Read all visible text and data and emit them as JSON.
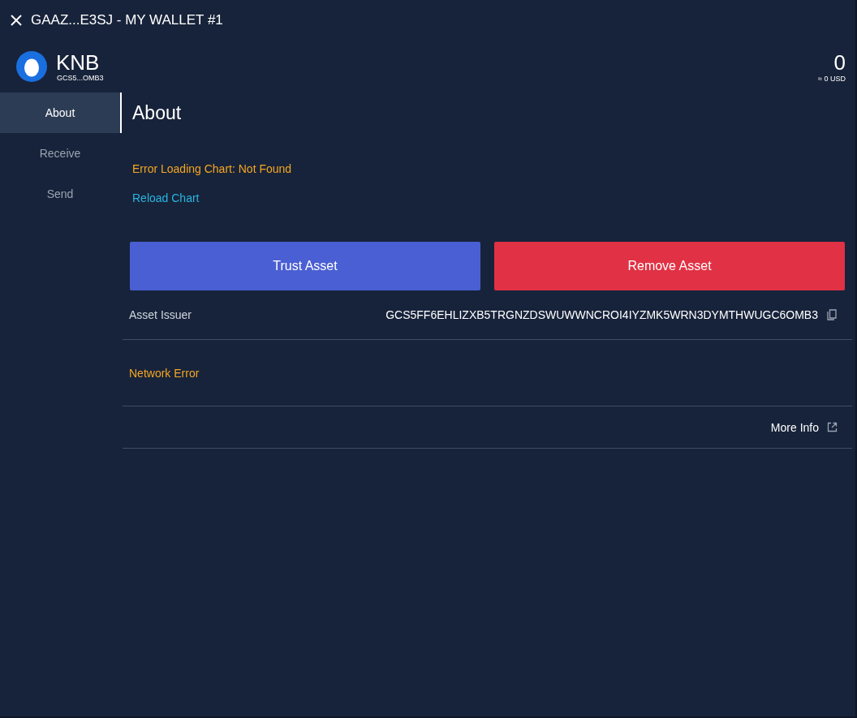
{
  "window": {
    "title": "GAAZ...E3SJ - MY WALLET #1"
  },
  "asset": {
    "code": "KNB",
    "issuer_short": "GCS5...OMB3",
    "balance": "0",
    "balance_usd": "≈ 0 USD"
  },
  "sidebar": {
    "items": [
      {
        "label": "About",
        "selected": true
      },
      {
        "label": "Receive",
        "selected": false
      },
      {
        "label": "Send",
        "selected": false
      }
    ]
  },
  "content": {
    "heading": "About",
    "chart_error": "Error Loading Chart: Not Found",
    "reload_link": "Reload Chart",
    "buttons": [
      {
        "label": "Trust Asset",
        "kind": "primary"
      },
      {
        "label": "Remove Asset",
        "kind": "danger"
      }
    ],
    "issuer_label": "Asset Issuer",
    "issuer_value": "GCS5FF6EHLIZXB5TRGNZDSWUWWNCROI4IYZMK5WRN3DYMTHWUGC6OMB3",
    "network_error": "Network Error",
    "more_info": "More Info"
  }
}
